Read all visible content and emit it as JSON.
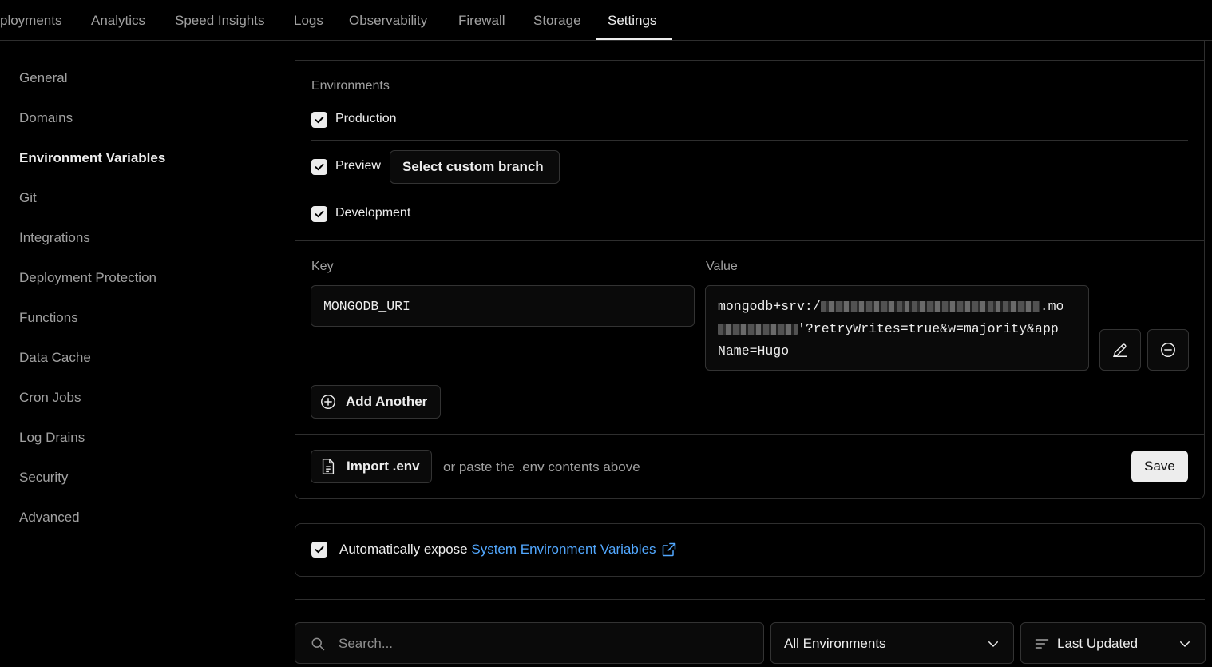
{
  "topnav": {
    "tabs": [
      {
        "label": "ployments"
      },
      {
        "label": "Analytics"
      },
      {
        "label": "Speed Insights"
      },
      {
        "label": "Logs"
      },
      {
        "label": "Observability"
      },
      {
        "label": "Firewall"
      },
      {
        "label": "Storage"
      },
      {
        "label": "Settings"
      }
    ],
    "active_tab": "Settings"
  },
  "sidebar": {
    "items": [
      {
        "label": "General"
      },
      {
        "label": "Domains"
      },
      {
        "label": "Environment Variables"
      },
      {
        "label": "Git"
      },
      {
        "label": "Integrations"
      },
      {
        "label": "Deployment Protection"
      },
      {
        "label": "Functions"
      },
      {
        "label": "Data Cache"
      },
      {
        "label": "Cron Jobs"
      },
      {
        "label": "Log Drains"
      },
      {
        "label": "Security"
      },
      {
        "label": "Advanced"
      }
    ],
    "active_item": "Environment Variables"
  },
  "environments": {
    "heading": "Environments",
    "production": {
      "label": "Production",
      "checked": true
    },
    "preview": {
      "label": "Preview",
      "checked": true,
      "branch_button": "Select custom branch"
    },
    "development": {
      "label": "Development",
      "checked": true
    }
  },
  "variable": {
    "key_label": "Key",
    "value_label": "Value",
    "key": "MONGODB_URI",
    "value_line1_start": "mongodb+srv:/",
    "value_line1_end": ".mo",
    "value_line2_end": "'?retryWrites=true&w=majority&app",
    "value_line3": "Name=Hugo"
  },
  "actions": {
    "add_another": "Add Another",
    "import_env": "Import .env",
    "paste_hint": "or paste the .env contents above",
    "save": "Save"
  },
  "system_vars": {
    "checked": true,
    "prefix": "Automatically expose",
    "link": "System Environment Variables"
  },
  "filters": {
    "search_placeholder": "Search...",
    "environment_select": "All Environments",
    "sort_select": "Last Updated"
  },
  "colors": {
    "background": "#000000",
    "border": "#2e2e2e",
    "text": "#ededed",
    "muted": "#a1a1a1",
    "link": "#52a8ff"
  }
}
